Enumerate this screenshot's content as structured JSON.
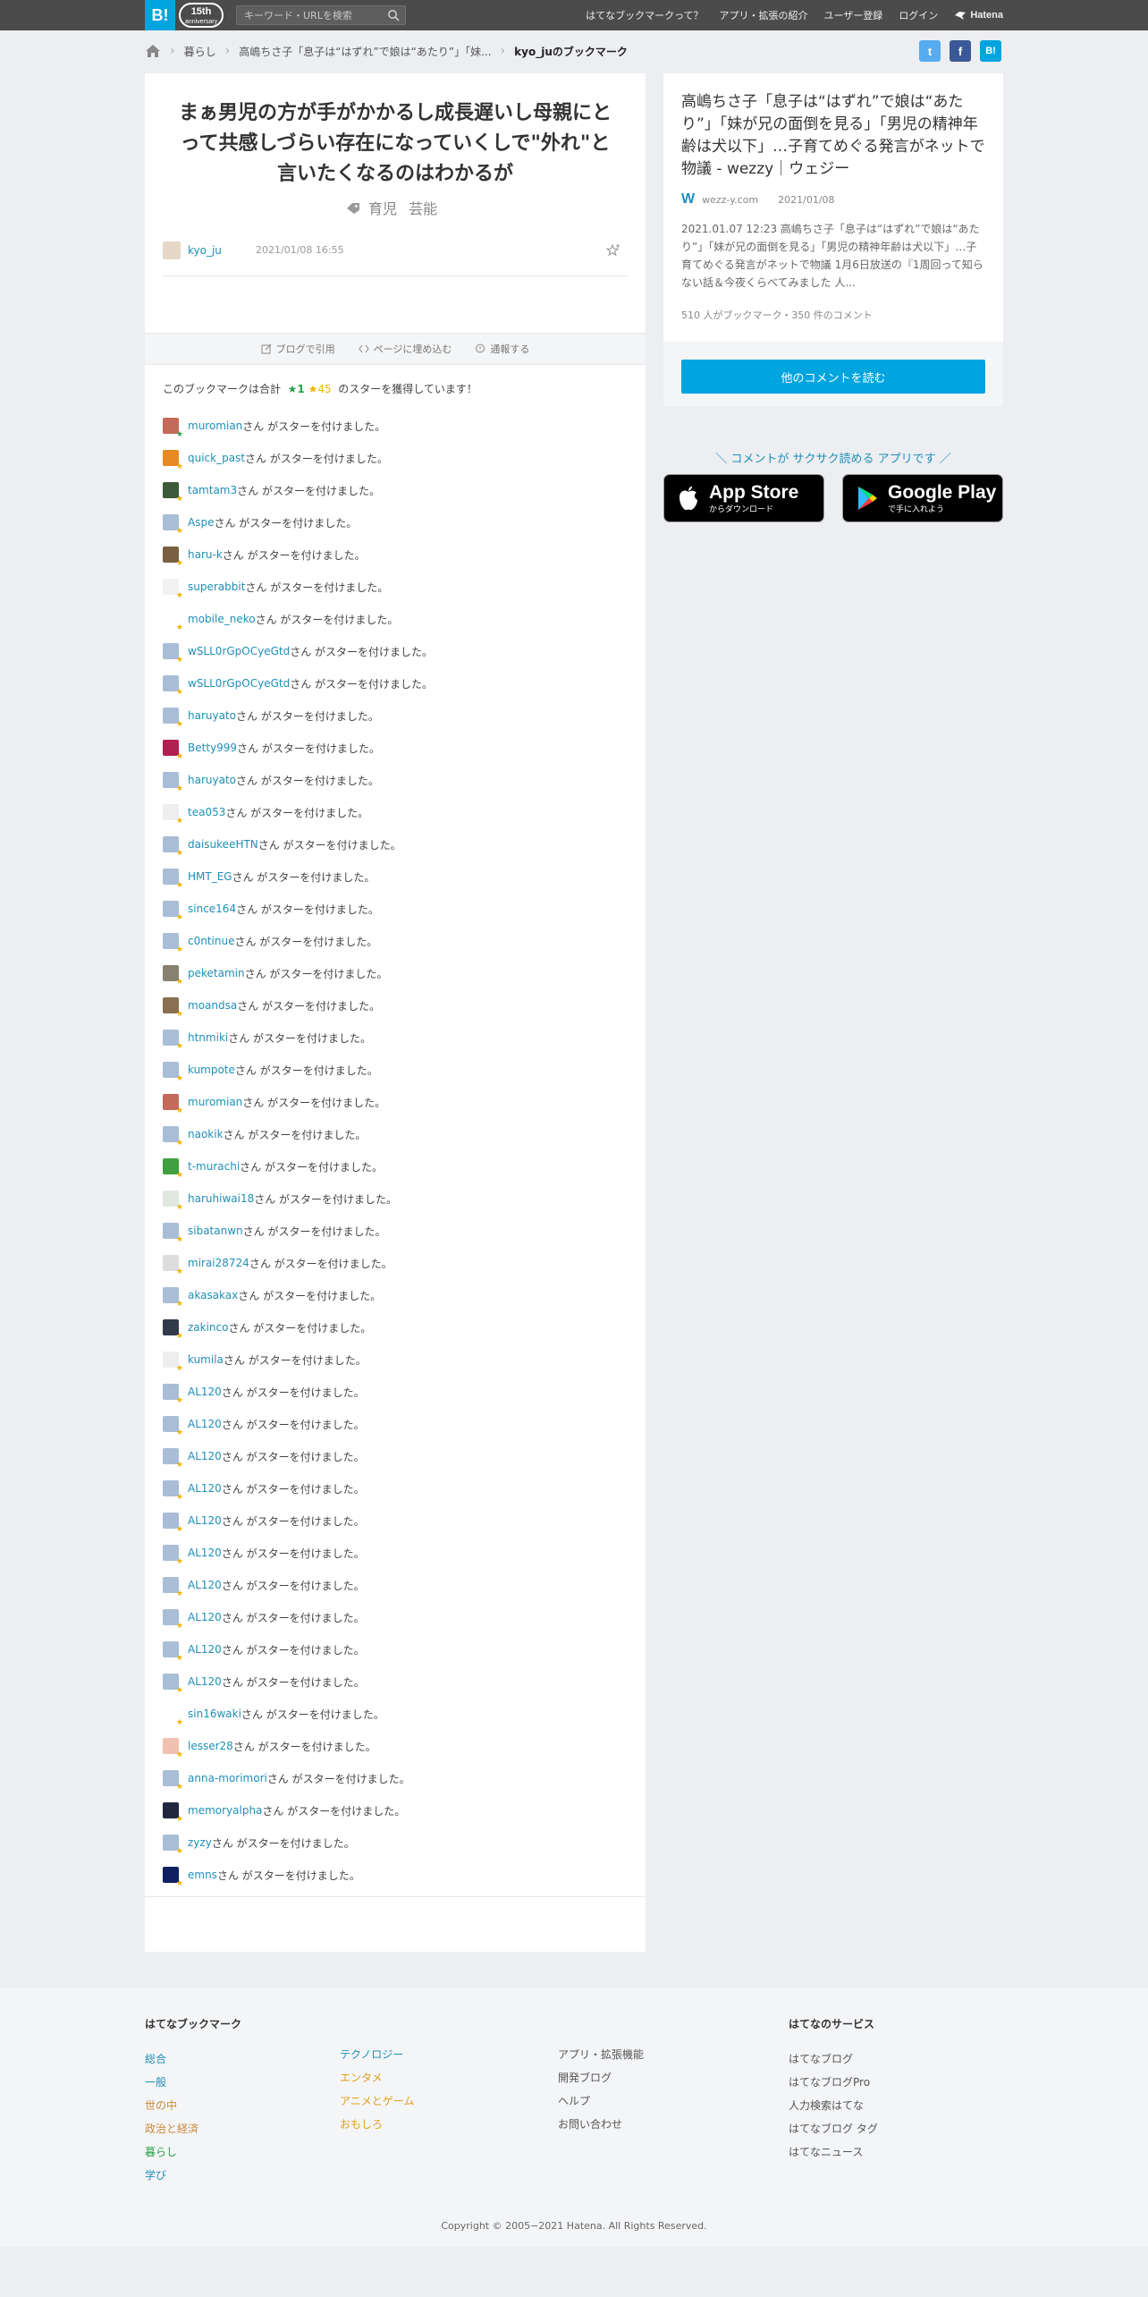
{
  "header": {
    "logo": "B!",
    "anniversary": "15th",
    "anniversary_sub": "anniversary",
    "search_placeholder": "キーワード・URLを検索",
    "nav": [
      "はてなブックマークって？",
      "アプリ・拡張の紹介",
      "ユーザー登録",
      "ログイン"
    ],
    "hatena_logo": "Hatena"
  },
  "breadcrumb": {
    "items": [
      "暮らし",
      "高嶋ちさ子「息子は“はずれ”で娘は“あたり”」「妹..."
    ],
    "current": "kyo_juのブックマーク"
  },
  "share": {
    "twitter": "t",
    "facebook": "f",
    "hatena": "B!"
  },
  "bookmark": {
    "comment": "まぁ男児の方が手がかかるし成長遅いし母親にとって共感しづらい存在になっていくしで\"外れ\"と言いたくなるのはわかるが",
    "tags": [
      "育児",
      "芸能"
    ],
    "user": "kyo_ju",
    "date": "2021/01/08 16:55"
  },
  "tools": [
    "ブログで引用",
    "ページに埋め込む",
    "通報する"
  ],
  "star_summary": {
    "prefix": "このブックマークは合計",
    "green": "★1",
    "yellow": "★45",
    "suffix": "のスターを獲得しています！"
  },
  "star_suffix": "さん がスターを付けました。",
  "stars": [
    {
      "user": "muromian",
      "color": "green",
      "av": "#c46a5a"
    },
    {
      "user": "quick_past",
      "color": "yellow",
      "av": "#e88a20"
    },
    {
      "user": "tamtam3",
      "color": "yellow",
      "av": "#3c5a3a"
    },
    {
      "user": "Aspe",
      "color": "yellow",
      "av": "#a9bdd6"
    },
    {
      "user": "haru-k",
      "color": "yellow",
      "av": "#7a6040"
    },
    {
      "user": "superabbit",
      "color": "yellow",
      "av": "#f2f2f2"
    },
    {
      "user": "mobile_neko",
      "color": "yellow",
      "av": "#ffffff"
    },
    {
      "user": "wSLL0rGpOCyeGtd",
      "color": "yellow",
      "av": "#a9bdd6"
    },
    {
      "user": "wSLL0rGpOCyeGtd",
      "color": "yellow",
      "av": "#a9bdd6"
    },
    {
      "user": "haruyato",
      "color": "yellow",
      "av": "#a9bdd6"
    },
    {
      "user": "Betty999",
      "color": "yellow",
      "av": "#b02050"
    },
    {
      "user": "haruyato",
      "color": "yellow",
      "av": "#a9bdd6"
    },
    {
      "user": "tea053",
      "color": "yellow",
      "av": "#eeeeee"
    },
    {
      "user": "daisukeeHTN",
      "color": "yellow",
      "av": "#a9bdd6"
    },
    {
      "user": "HMT_EG",
      "color": "yellow",
      "av": "#a9bdd6"
    },
    {
      "user": "since164",
      "color": "yellow",
      "av": "#a9bdd6"
    },
    {
      "user": "c0ntinue",
      "color": "yellow",
      "av": "#a9bdd6"
    },
    {
      "user": "peketamin",
      "color": "yellow",
      "av": "#8a8070"
    },
    {
      "user": "moandsa",
      "color": "yellow",
      "av": "#8a7050"
    },
    {
      "user": "htnmiki",
      "color": "yellow",
      "av": "#a9bdd6"
    },
    {
      "user": "kumpote",
      "color": "yellow",
      "av": "#a9bdd6"
    },
    {
      "user": "muromian",
      "color": "yellow",
      "av": "#c46a5a"
    },
    {
      "user": "naokik",
      "color": "yellow",
      "av": "#a9bdd6"
    },
    {
      "user": "t-murachi",
      "color": "yellow",
      "av": "#40a040"
    },
    {
      "user": "haruhiwai18",
      "color": "yellow",
      "av": "#e0e8e0"
    },
    {
      "user": "sibatanwn",
      "color": "yellow",
      "av": "#a9bdd6"
    },
    {
      "user": "mirai28724",
      "color": "yellow",
      "av": "#dddddd"
    },
    {
      "user": "akasakax",
      "color": "yellow",
      "av": "#a9bdd6"
    },
    {
      "user": "zakinco",
      "color": "yellow",
      "av": "#303a48"
    },
    {
      "user": "kumila",
      "color": "yellow",
      "av": "#eeeeee"
    },
    {
      "user": "AL120",
      "color": "yellow",
      "av": "#a9bdd6"
    },
    {
      "user": "AL120",
      "color": "yellow",
      "av": "#a9bdd6"
    },
    {
      "user": "AL120",
      "color": "yellow",
      "av": "#a9bdd6"
    },
    {
      "user": "AL120",
      "color": "yellow",
      "av": "#a9bdd6"
    },
    {
      "user": "AL120",
      "color": "yellow",
      "av": "#a9bdd6"
    },
    {
      "user": "AL120",
      "color": "yellow",
      "av": "#a9bdd6"
    },
    {
      "user": "AL120",
      "color": "yellow",
      "av": "#a9bdd6"
    },
    {
      "user": "AL120",
      "color": "yellow",
      "av": "#a9bdd6"
    },
    {
      "user": "AL120",
      "color": "yellow",
      "av": "#a9bdd6"
    },
    {
      "user": "AL120",
      "color": "yellow",
      "av": "#a9bdd6"
    },
    {
      "user": "sin16waki",
      "color": "yellow",
      "av": "#ffffff"
    },
    {
      "user": "lesser28",
      "color": "yellow",
      "av": "#f0c0b0"
    },
    {
      "user": "anna-morimori",
      "color": "yellow",
      "av": "#a9bdd6"
    },
    {
      "user": "memoryalpha",
      "color": "yellow",
      "av": "#202840"
    },
    {
      "user": "zyzy",
      "color": "yellow",
      "av": "#a9bdd6"
    },
    {
      "user": "emns",
      "color": "yellow",
      "av": "#102060"
    }
  ],
  "entry": {
    "title": "高嶋ちさ子「息子は“はずれ”で娘は“あたり”」「妹が兄の面倒を見る」「男児の精神年齢は犬以下」…子育てめぐる発言がネットで物議 - wezzy｜ウェジー",
    "site_icon": "W",
    "site": "wezz-y.com",
    "date": "2021/01/08",
    "description": "2021.01.07 12:23 高嶋ちさ子「息子は“はずれ”で娘は“あたり”」「妹が兄の面倒を見る」「男児の精神年齢は犬以下」…子育てめぐる発言がネットで物議 1月6日放送の『1周回って知らない話＆今夜くらべてみました 人...",
    "counts": "510 人がブックマーク・350 件のコメント",
    "read_more": "他のコメントを読む"
  },
  "app_promo": {
    "text": "＼ コメントが サクサク読める アプリです ／",
    "appstore_big": "App Store",
    "appstore_small": "からダウンロード",
    "gplay_big": "Google Play",
    "gplay_small": "で手に入れよう"
  },
  "footer": {
    "title": "はてなブックマーク",
    "col1": [
      {
        "label": "総合",
        "color": "#1f8fb8"
      },
      {
        "label": "一般",
        "color": "#1f8fb8"
      },
      {
        "label": "世の中",
        "color": "#c88a3a"
      },
      {
        "label": "政治と経済",
        "color": "#c88a3a"
      },
      {
        "label": "暮らし",
        "color": "#2aa24b"
      },
      {
        "label": "学び",
        "color": "#1f8fb8"
      }
    ],
    "col2": [
      {
        "label": "テクノロジー",
        "color": "#1f8fb8"
      },
      {
        "label": "エンタメ",
        "color": "#e0a020"
      },
      {
        "label": "アニメとゲーム",
        "color": "#e0a020"
      },
      {
        "label": "おもしろ",
        "color": "#e0a020"
      }
    ],
    "col3": [
      "アプリ・拡張機能",
      "開発ブログ",
      "ヘルプ",
      "お問い合わせ"
    ],
    "services_title": "はてなのサービス",
    "services": [
      "はてなブログ",
      "はてなブログPro",
      "人力検索はてな",
      "はてなブログ タグ",
      "はてなニュース"
    ],
    "copyright": "Copyright © 2005−2021 Hatena. All Rights Reserved."
  },
  "colors": {
    "accent": "#00a4de",
    "link": "#1f8fb8",
    "star_green": "#2aa24b",
    "star_yellow": "#efb400"
  }
}
